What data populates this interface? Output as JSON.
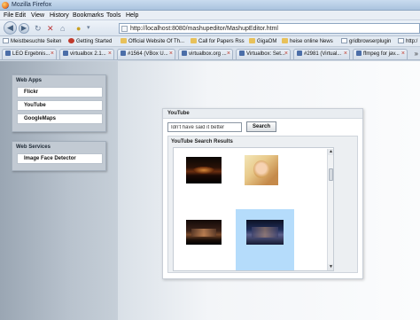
{
  "window": {
    "title": "Mozilla Firefox"
  },
  "menu": [
    "File",
    "Edit",
    "View",
    "History",
    "Bookmarks",
    "Tools",
    "Help"
  ],
  "navigation": {
    "url": "http://localhost:8080/mashupeditor/MashupEditor.html"
  },
  "bookmarks": [
    "Meistbesuchte Seiten",
    "Getting Started",
    "Official Website Of Th...",
    "Call for Papers Rss",
    "GigaOM",
    "heise online News",
    "gridbrowserplugin",
    "http:/"
  ],
  "tabs": [
    "LEO Ergebnis...",
    "virtualbox 2.1...",
    "#1564 (VBox U...",
    "virtualbox.org ...",
    "Virtualbox: Set...",
    "#2981 (Virtual...",
    "ffmpeg for jav..."
  ],
  "sidebar": {
    "web_apps": {
      "header": "Web Apps",
      "items": [
        "Flickr",
        "YouTube",
        "GoogleMaps"
      ]
    },
    "web_services": {
      "header": "Web Services",
      "items": [
        "Image Face Detector"
      ]
    }
  },
  "youtube": {
    "title": "YouTube",
    "search_value": "Idn't have said it better",
    "search_button": "Search",
    "results_title": "YouTube Search Results"
  },
  "colors": {
    "selected_result": "#b5dcfb",
    "sidebar": "#9aa6b3"
  }
}
